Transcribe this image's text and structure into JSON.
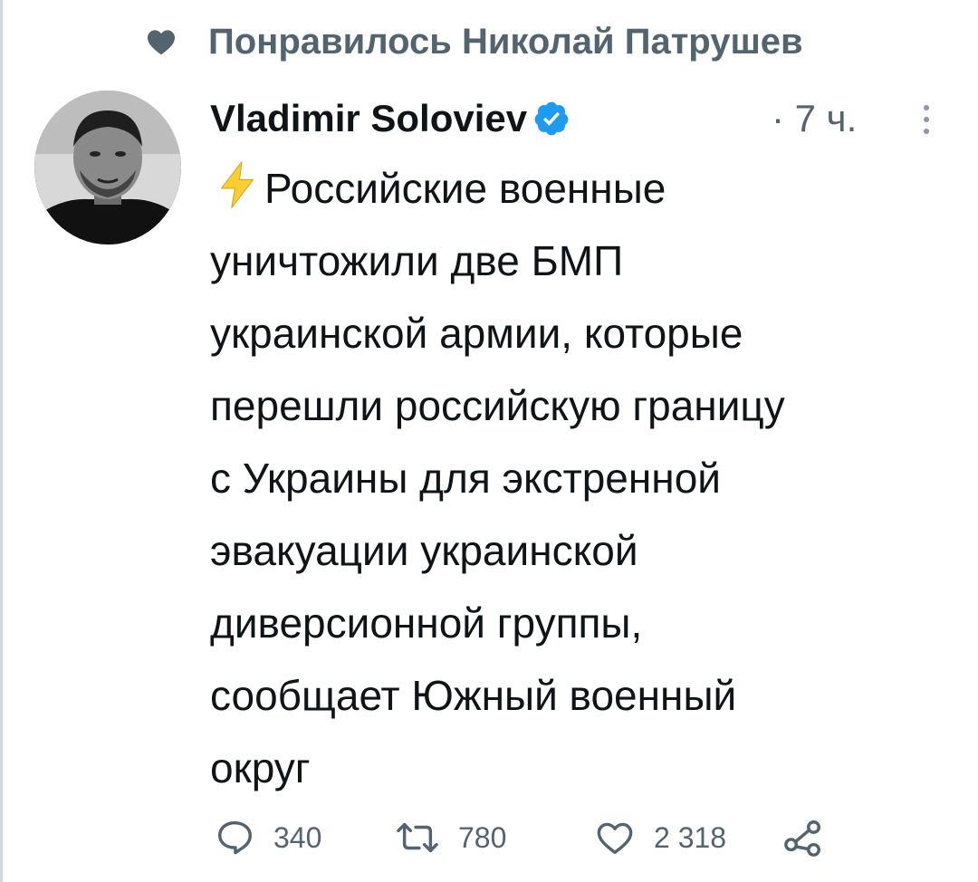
{
  "context": {
    "text": "Понравилось Николай Патрушев",
    "icon": "heart-filled-icon"
  },
  "tweet": {
    "author_name": "Vladimir Soloviev",
    "verified": true,
    "timestamp": "· 7 ч.",
    "emoji": "⚡",
    "body_lines": [
      "Российские военные",
      "уничтожили две БМП",
      "украинской армии, которые",
      "перешли российскую границу",
      "с Украины для экстренной",
      "эвакуации украинской",
      "диверсионной группы,",
      "сообщает Южный военный",
      "округ"
    ]
  },
  "actions": {
    "replies": "340",
    "retweets": "780",
    "likes": "2 318"
  },
  "colors": {
    "muted": "#536471",
    "verified": "#1d9bf0",
    "bolt": "#ffcc33",
    "text": "#0f1419"
  }
}
